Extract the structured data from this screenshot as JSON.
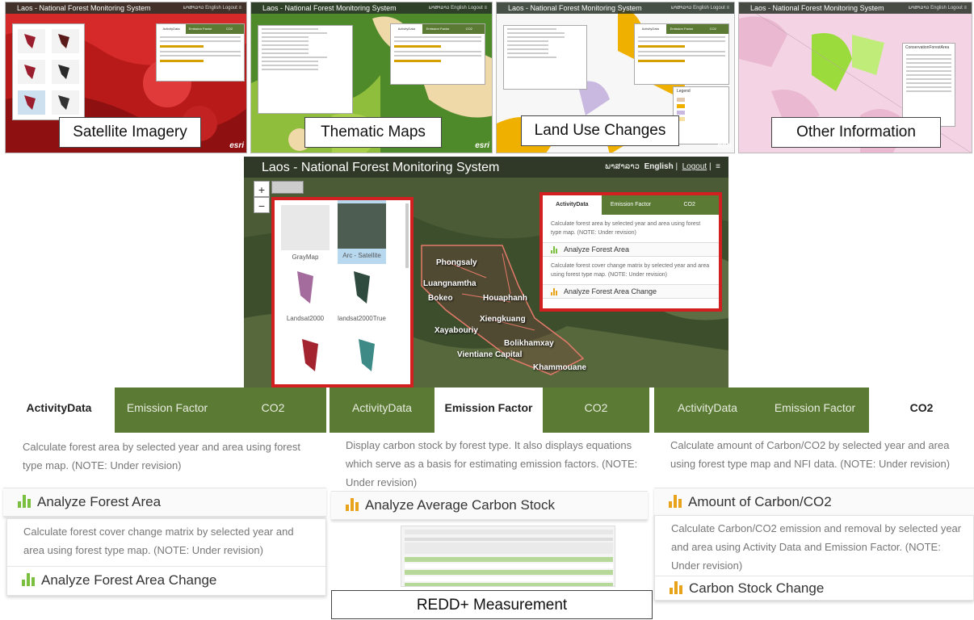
{
  "thumbnails": [
    {
      "title": "Laos - National Forest Monitoring System",
      "caption": "Satellite Imagery"
    },
    {
      "title": "Laos - National Forest Monitoring System",
      "caption": "Thematic Maps"
    },
    {
      "title": "Laos - National Forest Monitoring System",
      "caption": "Land Use Changes"
    },
    {
      "title": "Laos - National Forest Monitoring System",
      "caption": "Other Information"
    }
  ],
  "main_map": {
    "title": "Laos - National Forest Monitoring System",
    "header_links": [
      "ພາສາລາວ",
      "English",
      "Logout"
    ],
    "zoom_in": "+",
    "zoom_out": "−",
    "basemaps": [
      "GrayMap",
      "Arc - Satellite",
      "Landsat2000",
      "landsat2000True"
    ],
    "tabs": [
      "ActivityData",
      "Emission Factor",
      "CO2"
    ],
    "desc1": "Calculate forest area by selected year and area using forest type map. (NOTE: Under revision)",
    "action1": "Analyze Forest Area",
    "desc2": "Calculate forest cover change matrix by selected year and area using forest type map. (NOTE: Under revision)",
    "action2": "Analyze Forest Area Change",
    "provinces": [
      "Phongsaly",
      "Luangnamtha",
      "Bokeo",
      "Houaphanh",
      "Xiengkuang",
      "Xayabouriy",
      "Bolikhamxay",
      "Vientiane Capital",
      "Khammouane"
    ]
  },
  "activity_panel": {
    "tabs": [
      "ActivityData",
      "Emission Factor",
      "CO2"
    ],
    "desc1": "Calculate forest area by selected year and area using forest type map. (NOTE: Under revision)",
    "action1": "Analyze Forest Area",
    "desc2": "Calculate forest cover change matrix by selected year and area using forest type map. (NOTE: Under revision)",
    "action2": "Analyze Forest Area Change"
  },
  "emission_panel": {
    "tabs": [
      "ActivityData",
      "Emission Factor",
      "CO2"
    ],
    "desc": "Display carbon stock by forest type. It also displays equations which serve as a basis for estimating emission factors. (NOTE: Under revision)",
    "action": "Analyze Average Carbon Stock"
  },
  "co2_panel": {
    "tabs": [
      "ActivityData",
      "Emission Factor",
      "CO2"
    ],
    "desc1": "Calculate amount of Carbon/CO2 by selected year and area using forest type map and NFI data. (NOTE: Under revision)",
    "action1": "Amount of Carbon/CO2",
    "desc2": "Calculate Carbon/CO2 emission and removal by selected year and area using Activity Data and Emission Factor. (NOTE: Under revision)",
    "action2": "Carbon Stock Change"
  },
  "redd_label": "REDD+ Measurement",
  "colors": {
    "tab_green": "#5b7a34",
    "highlight_red": "#d21f1f",
    "icon_orange": "#e7a41a",
    "icon_green": "#7bbf3f"
  }
}
